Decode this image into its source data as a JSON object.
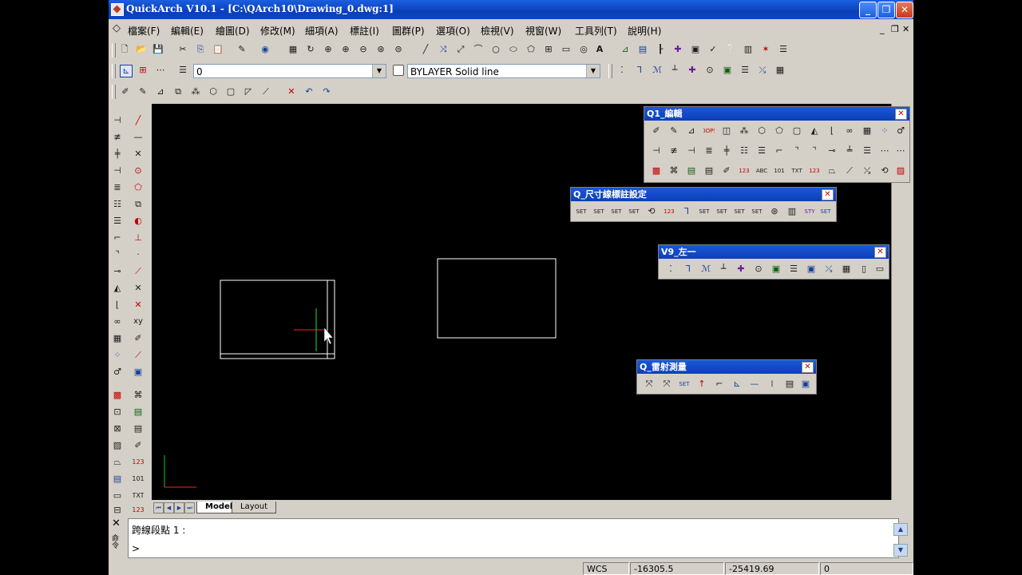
{
  "window": {
    "title": "QuickArch V10.1 - [C:\\QArch10\\Drawing_0.dwg:1]"
  },
  "menu": [
    "檔案(F)",
    "編輯(E)",
    "繪圖(D)",
    "修改(M)",
    "細項(A)",
    "標註(I)",
    "圖群(P)",
    "選項(O)",
    "檢視(V)",
    "視窗(W)",
    "工具列(T)",
    "說明(H)"
  ],
  "layer": {
    "value": "0"
  },
  "linetype": {
    "value": "BYLAYER Solid line"
  },
  "tabs": {
    "model": "Model",
    "layout": "Layout"
  },
  "palettes": {
    "q1_edit": "Q1_編輯",
    "q_dim": "Q_尺寸線標註設定",
    "v9_left": "V9_左一",
    "q_laser": "Q_雷射測量"
  },
  "command": {
    "line1": "跨線段點 1 :",
    "line2": ">",
    "label": "命令"
  },
  "status": {
    "wcs": "WCS",
    "x": "-16305.5",
    "y": "-25419.69",
    "z": "0"
  },
  "colors": {
    "titlebar": "#0a3fb8",
    "canvas": "#000000",
    "panel": "#d4d0c8"
  }
}
